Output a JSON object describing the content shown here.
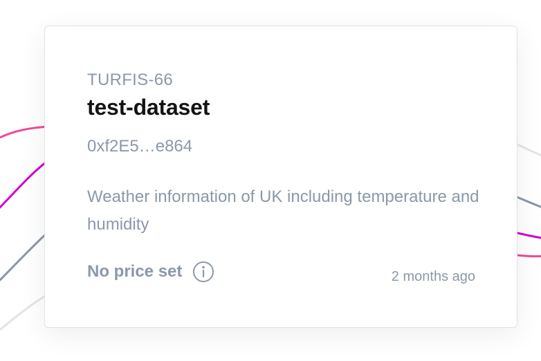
{
  "asset": {
    "symbol": "TURFIS-66",
    "name": "test-dataset",
    "owner_address": "0xf2E5…e864",
    "description": "Weather information of UK including temperature and humidity",
    "price_text": "No price set",
    "price_info_icon": "info-circle-icon",
    "updated": "2 months ago"
  },
  "colors": {
    "wave_pink": "#ee4b9b",
    "wave_magenta": "#d100d1",
    "wave_slate": "#8a95a8",
    "wave_light": "#e4e4e4",
    "muted_text": "#8b98a9",
    "title_text": "#141414",
    "card_border": "#e0e2e6"
  }
}
